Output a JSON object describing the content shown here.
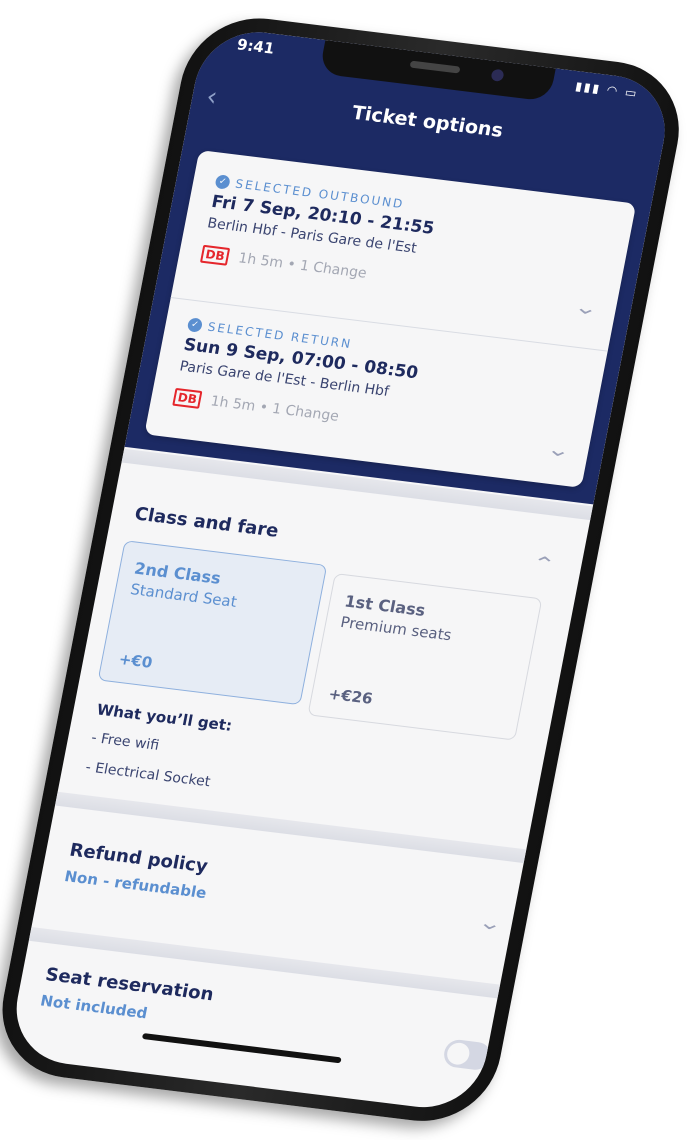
{
  "status_bar": {
    "time": "9:41",
    "icons": "signal wifi battery"
  },
  "header": {
    "title": "Ticket options",
    "back_icon": "chevron-left-icon"
  },
  "outbound": {
    "label": "SELECTED OUTBOUND",
    "date": "Fri 7 Sep, 20:10 - 21:55",
    "stations": "Berlin Hbf  -  Paris Gare de l'Est",
    "operator": "DB",
    "meta": "1h 5m • 1 Change"
  },
  "return": {
    "label": "SELECTED RETURN",
    "date": "Sun 9 Sep, 07:00 - 08:50",
    "stations": "Paris Gare de l'Est  -  Berlin Hbf",
    "operator": "DB",
    "meta": "1h 5m • 1 Change"
  },
  "class_fare": {
    "title": "Class and fare",
    "options": [
      {
        "name": "2nd Class",
        "desc": "Standard Seat",
        "price": "+€0",
        "selected": true
      },
      {
        "name": "1st Class",
        "desc": "Premium seats",
        "price": "+€26",
        "selected": false
      }
    ],
    "benefits_title": "What you’ll get:",
    "benefits": [
      "- Free wifi",
      "- Electrical Socket"
    ]
  },
  "refund": {
    "title": "Refund policy",
    "value": "Non - refundable"
  },
  "seat": {
    "title": "Seat reservation",
    "value": "Not included",
    "toggle_on": false
  },
  "colors": {
    "navy": "#1c2a64",
    "accent": "#5b8fd0",
    "db_red": "#e5262c"
  }
}
